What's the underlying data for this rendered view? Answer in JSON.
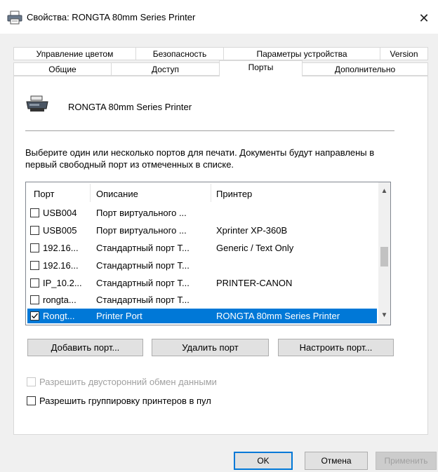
{
  "window": {
    "title": "Свойства: RONGTA 80mm Series Printer",
    "close_glyph": "✕"
  },
  "tabs": {
    "row_back": [
      "Управление цветом",
      "Безопасность",
      "Параметры устройства",
      "Version"
    ],
    "row_front": [
      "Общие",
      "Доступ",
      "Порты",
      "Дополнительно"
    ],
    "active": "Порты"
  },
  "printer": {
    "name": "RONGTA 80mm Series Printer",
    "icon": "printer-icon"
  },
  "description": "Выберите один или несколько портов для печати. Документы будут направлены в первый свободный порт из отмеченных в списке.",
  "ports": {
    "columns": [
      "Порт",
      "Описание",
      "Принтер"
    ],
    "rows": [
      {
        "port": "USB004",
        "desc": "Порт виртуального ...",
        "printer": "",
        "checked": false,
        "selected": false
      },
      {
        "port": "USB005",
        "desc": "Порт виртуального ...",
        "printer": "Xprinter XP-360B",
        "checked": false,
        "selected": false
      },
      {
        "port": "192.16...",
        "desc": "Стандартный порт T...",
        "printer": "Generic / Text Only",
        "checked": false,
        "selected": false
      },
      {
        "port": "192.16...",
        "desc": "Стандартный порт T...",
        "printer": "",
        "checked": false,
        "selected": false
      },
      {
        "port": "IP_10.2...",
        "desc": "Стандартный порт T...",
        "printer": "PRINTER-CANON",
        "checked": false,
        "selected": false
      },
      {
        "port": "rongta...",
        "desc": "Стандартный порт T...",
        "printer": "",
        "checked": false,
        "selected": false
      },
      {
        "port": "Rongt...",
        "desc": "Printer Port",
        "printer": "RONGTA 80mm Series Printer",
        "checked": true,
        "selected": true
      }
    ]
  },
  "port_buttons": {
    "add": "Добавить порт...",
    "delete": "Удалить порт",
    "configure": "Настроить порт..."
  },
  "options": {
    "bidirectional": {
      "label": "Разрешить двусторонний обмен данными",
      "checked": false,
      "disabled": true
    },
    "pooling": {
      "label": "Разрешить группировку принтеров в пул",
      "checked": false,
      "disabled": false
    }
  },
  "dialog_buttons": {
    "ok": "OK",
    "cancel": "Отмена",
    "apply": "Применить"
  },
  "colors": {
    "selection": "#0078d7",
    "panel": "#ffffff",
    "chrome": "#f0f0f0"
  }
}
